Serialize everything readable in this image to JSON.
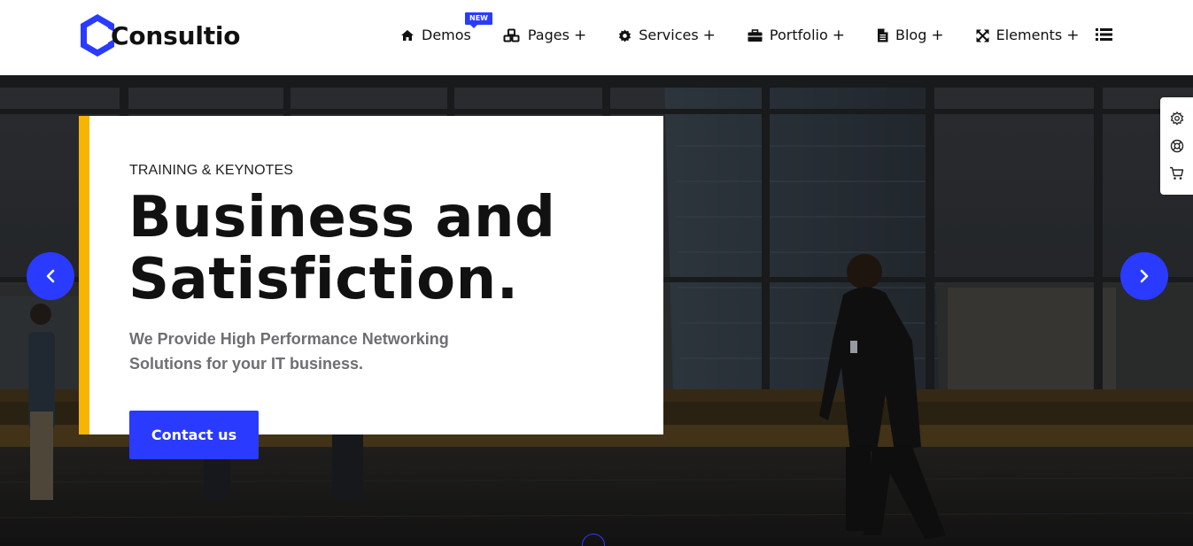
{
  "brand": {
    "name": "Consultio",
    "accent_color": "#2a3bff",
    "highlight_color": "#f7b500"
  },
  "nav": {
    "items": [
      {
        "label": "Demos",
        "icon": "home-icon",
        "badge": "NEW",
        "has_submenu": false
      },
      {
        "label": "Pages",
        "icon": "cubes-icon",
        "has_submenu": true
      },
      {
        "label": "Services",
        "icon": "gear-icon",
        "has_submenu": true
      },
      {
        "label": "Portfolio",
        "icon": "briefcase-icon",
        "has_submenu": true
      },
      {
        "label": "Blog",
        "icon": "document-icon",
        "has_submenu": true
      },
      {
        "label": "Elements",
        "icon": "expand-icon",
        "has_submenu": true
      }
    ],
    "plus_symbol": "+",
    "menu_icon": "list-menu-icon"
  },
  "hero": {
    "eyebrow": "TRAINING & KEYNOTES",
    "headline_line1": "Business and",
    "headline_line2": "Satisfiction.",
    "subtext": "We Provide High Performance Networking Solutions for your IT business.",
    "cta_label": "Contact us",
    "prev_icon": "chevron-left-icon",
    "next_icon": "chevron-right-icon"
  },
  "side_tools": [
    {
      "icon": "gear-icon"
    },
    {
      "icon": "lifebuoy-icon"
    },
    {
      "icon": "cart-icon"
    }
  ]
}
